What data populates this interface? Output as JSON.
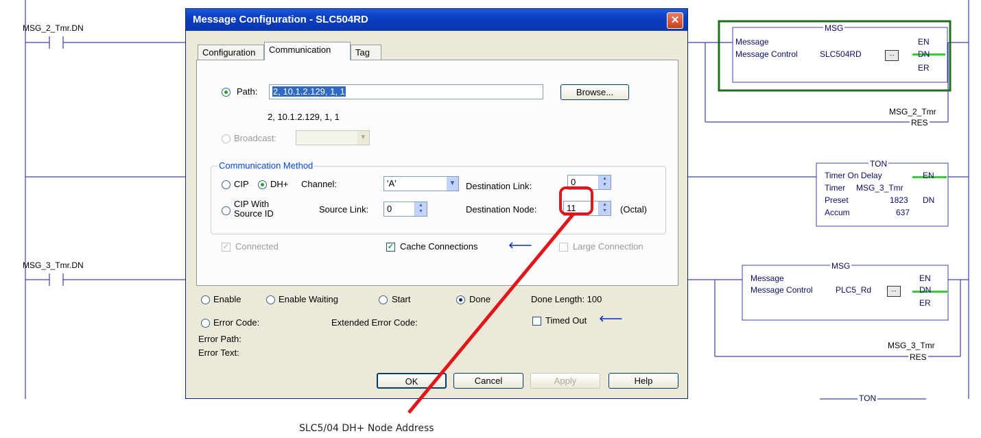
{
  "ladder": {
    "rung1_contact_tag": "MSG_2_Tmr.DN",
    "rung3_contact_tag": "MSG_3_Tmr.DN",
    "msg1": {
      "title": "MSG",
      "type_label": "Message",
      "control_label": "Message Control",
      "control_tag": "SLC504RD",
      "dots": "...",
      "en": "EN",
      "dn": "DN",
      "er": "ER"
    },
    "msg1_timer_tag": "MSG_2_Tmr",
    "msg1_res": "RES",
    "ton": {
      "title": "TON",
      "type_label": "Timer On Delay",
      "timer_label": "Timer",
      "timer_tag": "MSG_3_Tmr",
      "preset_label": "Preset",
      "preset_value": "1823",
      "accum_label": "Accum",
      "accum_value": "637",
      "en": "EN",
      "dn": "DN"
    },
    "msg2": {
      "title": "MSG",
      "type_label": "Message",
      "control_label": "Message Control",
      "control_tag": "PLC5_Rd",
      "dots": "...",
      "en": "EN",
      "dn": "DN",
      "er": "ER"
    },
    "msg2_timer_tag": "MSG_3_Tmr",
    "msg2_res": "RES",
    "ton2_title": "TON"
  },
  "dialog": {
    "title": "Message Configuration - SLC504RD",
    "close": "✕",
    "tabs": [
      "Configuration",
      "Communication",
      "Tag"
    ],
    "path_label": "Path:",
    "path_value": "2, 10.1.2.129, 1, 1",
    "path_resolved": "2, 10.1.2.129, 1, 1",
    "browse": "Browse...",
    "broadcast_label": "Broadcast:",
    "comm_method": {
      "title": "Communication Method",
      "cip": "CIP",
      "dhplus": "DH+",
      "cip_source_l1": "CIP With",
      "cip_source_l2": "Source ID",
      "channel_label": "Channel:",
      "channel_value": "'A'",
      "source_link_label": "Source Link:",
      "source_link_value": "0",
      "dest_link_label": "Destination Link:",
      "dest_link_value": "0",
      "dest_node_label": "Destination Node:",
      "dest_node_value": "11",
      "octal_label": "(Octal)"
    },
    "connected": "Connected",
    "cache_connections": "Cache Connections",
    "large_connection": "Large Connection",
    "status": {
      "enable": "Enable",
      "enable_waiting": "Enable Waiting",
      "start": "Start",
      "done": "Done",
      "done_length": "Done Length: 100",
      "error_code": "Error Code:",
      "extended_error_code": "Extended Error Code:",
      "timed_out": "Timed Out",
      "error_path": "Error Path:",
      "error_text": "Error Text:"
    },
    "buttons": {
      "ok": "OK",
      "cancel": "Cancel",
      "apply": "Apply",
      "help": "Help"
    }
  },
  "annotation": {
    "caption": "SLC5/04 DH+ Node Address",
    "color": "#e0161b"
  }
}
